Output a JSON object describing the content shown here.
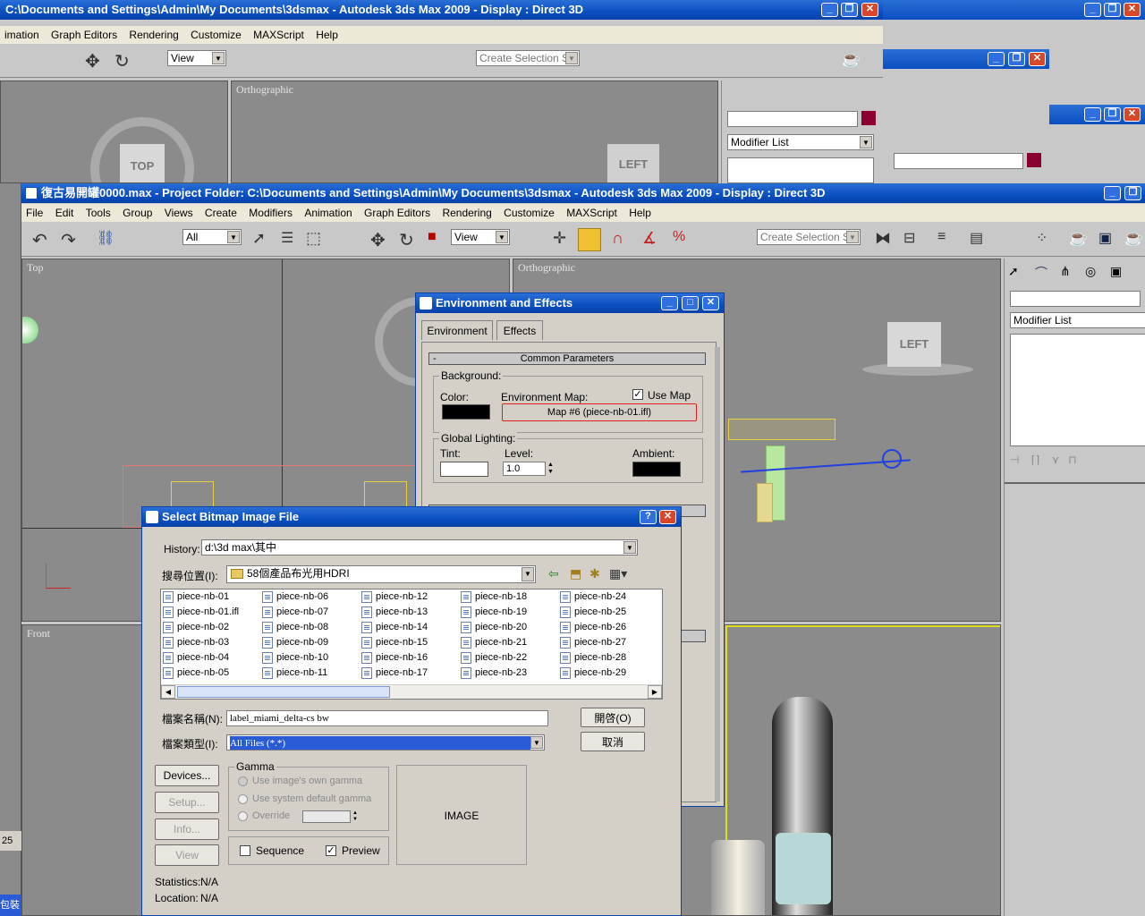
{
  "back_window": {
    "title": "C:\\Documents and Settings\\Admin\\My Documents\\3dsmax     - Autodesk 3ds Max  2009        - Display : Direct 3D",
    "menu": [
      "imation",
      "Graph Editors",
      "Rendering",
      "Customize",
      "MAXScript",
      "Help"
    ],
    "view_combo": "View",
    "selection_set": "Create Selection Set",
    "viewport_label": "Orthographic",
    "viewcube_top": "TOP",
    "viewcube_left": "LEFT",
    "modifier_list": "Modifier List"
  },
  "main_window": {
    "title": "復古易開罐0000.max     - Project Folder: C:\\Documents and Settings\\Admin\\My Documents\\3dsmax       - Autodesk 3ds Max  2009        - Display : Direct 3D",
    "menu": [
      "File",
      "Edit",
      "Tools",
      "Group",
      "Views",
      "Create",
      "Modifiers",
      "Animation",
      "Graph Editors",
      "Rendering",
      "Customize",
      "MAXScript",
      "Help"
    ],
    "filter_combo": "All",
    "view_combo": "View",
    "selection_set": "Create Selection Set",
    "viewports": {
      "top": "Top",
      "ortho": "Orthographic",
      "front": "Front"
    },
    "viewcube_left": "LEFT",
    "modifier_list": "Modifier List",
    "timeline_value": "25",
    "status_fragment": "包裝"
  },
  "env_dialog": {
    "title": "Environment and Effects",
    "tabs": [
      "Environment",
      "Effects"
    ],
    "rollout": "Common Parameters",
    "rollout_toggle": "-",
    "background_label": "Background:",
    "color_label": "Color:",
    "env_map_label": "Environment Map:",
    "use_map_label": "Use Map",
    "use_map_checked": true,
    "map_button": "Map #6 (piece-nb-01.ifl)",
    "global_lighting_label": "Global Lighting:",
    "tint_label": "Tint:",
    "level_label": "Level:",
    "level_value": "1.0",
    "ambient_label": "Ambient:",
    "background_color": "#000000",
    "tint_color": "#ffffff",
    "ambient_color": "#000000"
  },
  "file_dialog": {
    "title": "Select Bitmap Image File",
    "help_btn": "?",
    "history_label": "History:",
    "history_value": "d:\\3d max\\其中",
    "lookin_label": "搜尋位置(I):",
    "lookin_value": "58個產品布光用HDRI",
    "columns": [
      [
        "piece-nb-01",
        "piece-nb-01.ifl",
        "piece-nb-02",
        "piece-nb-03",
        "piece-nb-04",
        "piece-nb-05"
      ],
      [
        "piece-nb-06",
        "piece-nb-07",
        "piece-nb-08",
        "piece-nb-09",
        "piece-nb-10",
        "piece-nb-11"
      ],
      [
        "piece-nb-12",
        "piece-nb-13",
        "piece-nb-14",
        "piece-nb-15",
        "piece-nb-16",
        "piece-nb-17"
      ],
      [
        "piece-nb-18",
        "piece-nb-19",
        "piece-nb-20",
        "piece-nb-21",
        "piece-nb-22",
        "piece-nb-23"
      ],
      [
        "piece-nb-24",
        "piece-nb-25",
        "piece-nb-26",
        "piece-nb-27",
        "piece-nb-28",
        "piece-nb-29"
      ]
    ],
    "filename_label": "檔案名稱(N):",
    "filename_value": "label_miami_delta-cs bw",
    "filetype_label": "檔案類型(I):",
    "filetype_value": "All Files (*.*)",
    "open_btn": "開啓(O)",
    "cancel_btn": "取消",
    "devices_btn": "Devices...",
    "setup_btn": "Setup...",
    "info_btn": "Info...",
    "view_btn": "View",
    "gamma_title": "Gamma",
    "gamma_own": "Use image's own gamma",
    "gamma_system": "Use system default gamma",
    "gamma_override": "Override",
    "sequence_label": "Sequence",
    "preview_label": "Preview",
    "preview_checked": true,
    "image_placeholder": "IMAGE",
    "statistics_label": "Statistics:",
    "statistics_value": "N/A",
    "location_label": "Location:",
    "location_value": "N/A"
  },
  "colors": {
    "title_blue": "#0a4fc0",
    "viewport_grey": "#8b8b8b",
    "selection_blue": "#2a5bd7",
    "map_highlight": "#e02020"
  }
}
